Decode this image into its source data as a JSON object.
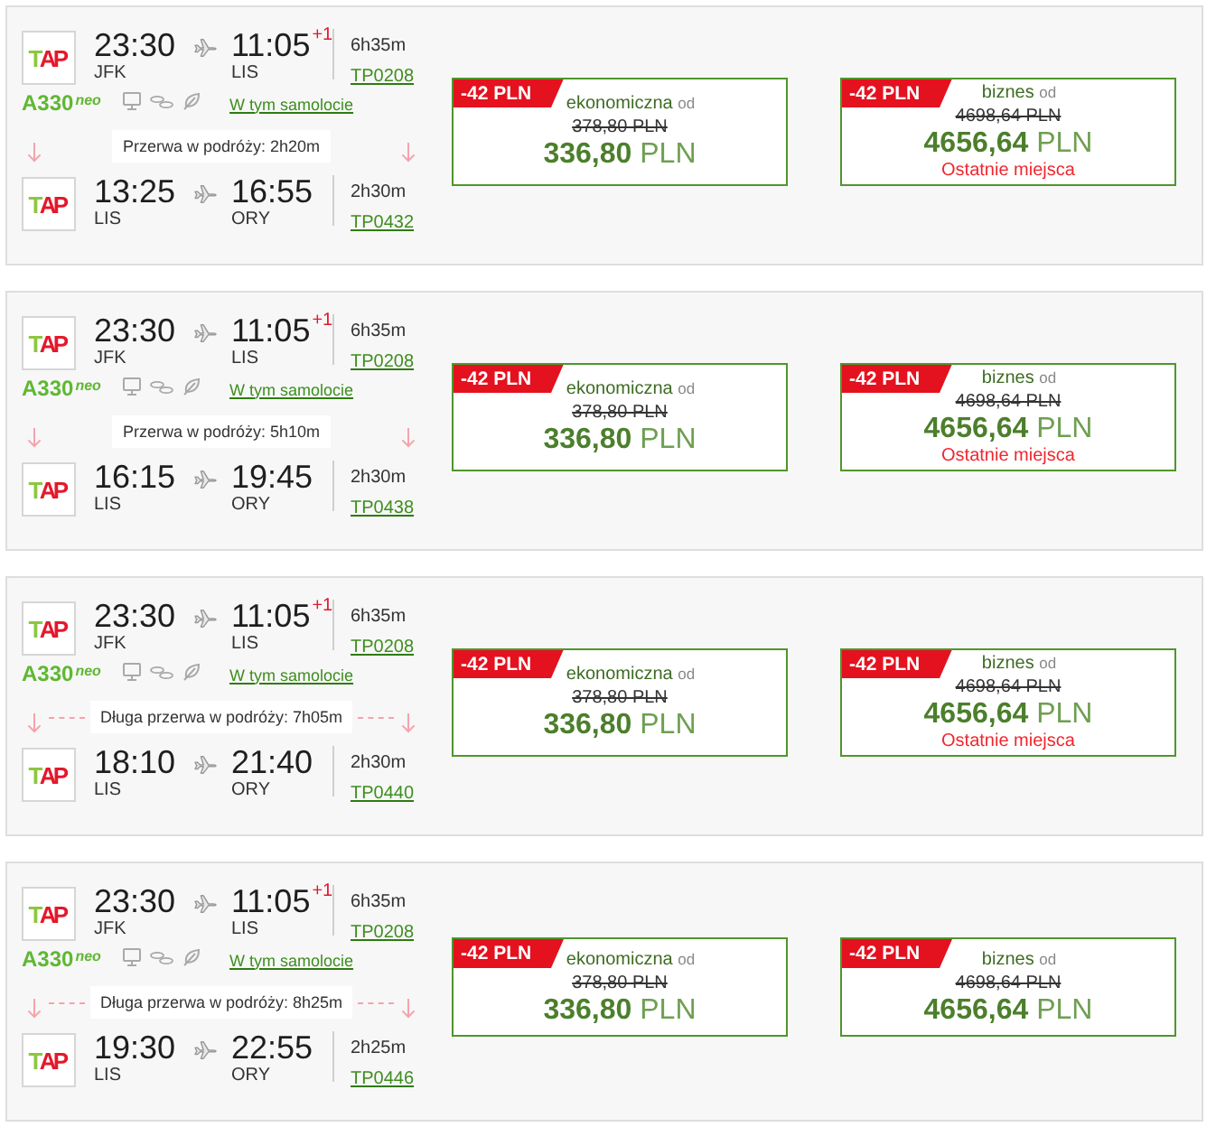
{
  "results": [
    {
      "outbound": {
        "airline": "TAP",
        "departure_time": "23:30",
        "departure_airport": "JFK",
        "arrival_time": "11:05",
        "day_offset": "+1",
        "arrival_airport": "LIS",
        "duration": "6h35m",
        "flight_number": "TP0208"
      },
      "aircraft": {
        "model": "A330",
        "variant": "neo",
        "link": "W tym samolocie"
      },
      "layover": {
        "label": "Przerwa w podróży: 2h20m",
        "long": false
      },
      "connection": {
        "airline": "TAP",
        "departure_time": "13:25",
        "departure_airport": "LIS",
        "arrival_time": "16:55",
        "arrival_airport": "ORY",
        "duration": "2h30m",
        "flight_number": "TP0432"
      },
      "fares": [
        {
          "discount": "-42 PLN",
          "cabin": "ekonomiczna",
          "cabin_suffix": "od",
          "old_price": "378,80 PLN",
          "price": "336,80",
          "currency": "PLN"
        },
        {
          "discount": "-42 PLN",
          "cabin": "biznes",
          "cabin_suffix": "od",
          "old_price": "4698,64 PLN",
          "price": "4656,64",
          "currency": "PLN",
          "note": "Ostatnie miejsca"
        }
      ]
    },
    {
      "outbound": {
        "airline": "TAP",
        "departure_time": "23:30",
        "departure_airport": "JFK",
        "arrival_time": "11:05",
        "day_offset": "+1",
        "arrival_airport": "LIS",
        "duration": "6h35m",
        "flight_number": "TP0208"
      },
      "aircraft": {
        "model": "A330",
        "variant": "neo",
        "link": "W tym samolocie"
      },
      "layover": {
        "label": "Przerwa w podróży: 5h10m",
        "long": false
      },
      "connection": {
        "airline": "TAP",
        "departure_time": "16:15",
        "departure_airport": "LIS",
        "arrival_time": "19:45",
        "arrival_airport": "ORY",
        "duration": "2h30m",
        "flight_number": "TP0438"
      },
      "fares": [
        {
          "discount": "-42 PLN",
          "cabin": "ekonomiczna",
          "cabin_suffix": "od",
          "old_price": "378,80 PLN",
          "price": "336,80",
          "currency": "PLN"
        },
        {
          "discount": "-42 PLN",
          "cabin": "biznes",
          "cabin_suffix": "od",
          "old_price": "4698,64 PLN",
          "price": "4656,64",
          "currency": "PLN",
          "note": "Ostatnie miejsca"
        }
      ]
    },
    {
      "outbound": {
        "airline": "TAP",
        "departure_time": "23:30",
        "departure_airport": "JFK",
        "arrival_time": "11:05",
        "day_offset": "+1",
        "arrival_airport": "LIS",
        "duration": "6h35m",
        "flight_number": "TP0208"
      },
      "aircraft": {
        "model": "A330",
        "variant": "neo",
        "link": "W tym samolocie"
      },
      "layover": {
        "label": "Długa przerwa w podróży: 7h05m",
        "long": true
      },
      "connection": {
        "airline": "TAP",
        "departure_time": "18:10",
        "departure_airport": "LIS",
        "arrival_time": "21:40",
        "arrival_airport": "ORY",
        "duration": "2h30m",
        "flight_number": "TP0440"
      },
      "fares": [
        {
          "discount": "-42 PLN",
          "cabin": "ekonomiczna",
          "cabin_suffix": "od",
          "old_price": "378,80 PLN",
          "price": "336,80",
          "currency": "PLN"
        },
        {
          "discount": "-42 PLN",
          "cabin": "biznes",
          "cabin_suffix": "od",
          "old_price": "4698,64 PLN",
          "price": "4656,64",
          "currency": "PLN",
          "note": "Ostatnie miejsca"
        }
      ]
    },
    {
      "outbound": {
        "airline": "TAP",
        "departure_time": "23:30",
        "departure_airport": "JFK",
        "arrival_time": "11:05",
        "day_offset": "+1",
        "arrival_airport": "LIS",
        "duration": "6h35m",
        "flight_number": "TP0208"
      },
      "aircraft": {
        "model": "A330",
        "variant": "neo",
        "link": "W tym samolocie"
      },
      "layover": {
        "label": "Długa przerwa w podróży: 8h25m",
        "long": true
      },
      "connection": {
        "airline": "TAP",
        "departure_time": "19:30",
        "departure_airport": "LIS",
        "arrival_time": "22:55",
        "arrival_airport": "ORY",
        "duration": "2h25m",
        "flight_number": "TP0446"
      },
      "fares": [
        {
          "discount": "-42 PLN",
          "cabin": "ekonomiczna",
          "cabin_suffix": "od",
          "old_price": "378,80 PLN",
          "price": "336,80",
          "currency": "PLN"
        },
        {
          "discount": "-42 PLN",
          "cabin": "biznes",
          "cabin_suffix": "od",
          "old_price": "4698,64 PLN",
          "price": "4656,64",
          "currency": "PLN"
        }
      ]
    }
  ]
}
